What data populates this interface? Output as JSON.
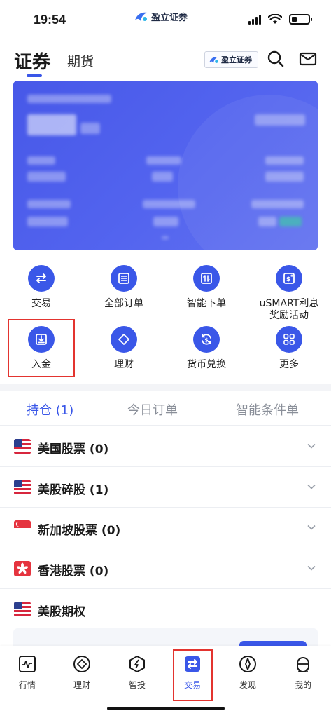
{
  "status_bar": {
    "time": "19:54",
    "brand": "盈立证券",
    "battery_level": 0.3
  },
  "header": {
    "tabs": [
      {
        "label": "证券",
        "active": true
      },
      {
        "label": "期货",
        "active": false
      }
    ],
    "broker_badge": "盈立证券",
    "icons": [
      "search-icon",
      "mail-icon"
    ]
  },
  "account_card": {
    "content": "redacted"
  },
  "quick_actions": [
    {
      "label": "交易",
      "icon": "swap-icon"
    },
    {
      "label": "全部订单",
      "icon": "order-list-icon"
    },
    {
      "label": "智能下单",
      "icon": "smart-order-icon"
    },
    {
      "label": "uSMART利息奖励活动",
      "label_lines": [
        "uSMART利息",
        "奖励活动"
      ],
      "icon": "reward-icon"
    },
    {
      "label": "入金",
      "icon": "deposit-icon",
      "highlighted": true
    },
    {
      "label": "理财",
      "icon": "diamond-icon"
    },
    {
      "label": "货币兑换",
      "icon": "currency-exchange-icon"
    },
    {
      "label": "更多",
      "icon": "grid-icon"
    }
  ],
  "position_tabs": [
    {
      "label": "持仓 (1)",
      "active": true
    },
    {
      "label": "今日订单",
      "active": false
    },
    {
      "label": "智能条件单",
      "active": false
    }
  ],
  "markets": [
    {
      "label": "美国股票 (0)",
      "flag": "us-flag-icon",
      "expandable": true
    },
    {
      "label": "美股碎股 (1)",
      "flag": "us-flag-icon",
      "expandable": true
    },
    {
      "label": "新加坡股票 (0)",
      "flag": "sg-flag-icon",
      "expandable": true
    },
    {
      "label": "香港股票 (0)",
      "flag": "hk-flag-icon",
      "expandable": true
    },
    {
      "label": "美股期权",
      "flag": "us-flag-icon",
      "expandable": false
    }
  ],
  "bottom_nav": [
    {
      "label": "行情",
      "icon": "market-icon"
    },
    {
      "label": "理财",
      "icon": "wealth-icon"
    },
    {
      "label": "智投",
      "icon": "robo-advisor-icon"
    },
    {
      "label": "交易",
      "icon": "trade-icon",
      "active": true
    },
    {
      "label": "发现",
      "icon": "compass-icon"
    },
    {
      "label": "我的",
      "icon": "profile-icon"
    }
  ],
  "colors": {
    "accent": "#3a57e8",
    "card": "#4f60ed",
    "highlight": "#e3342f"
  }
}
